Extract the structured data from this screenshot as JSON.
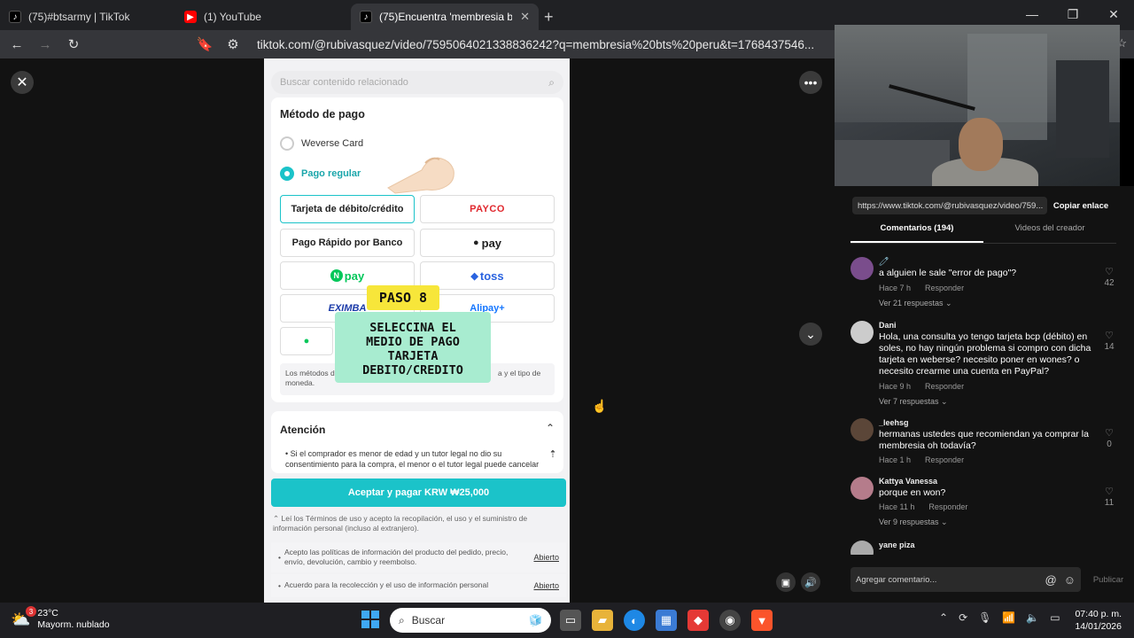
{
  "browser": {
    "tabs": [
      {
        "label": "(75)#btsarmy | TikTok",
        "icon": "tiktok-icon",
        "active": false
      },
      {
        "label": "(1) YouTube",
        "icon": "youtube-icon",
        "active": false
      },
      {
        "label": "(75)Encuentra 'membresia bts",
        "icon": "tiktok-icon",
        "active": true
      }
    ],
    "url": "tiktok.com/@rubivasquez/video/7595064021338836242?q=membresia%20bts%20peru&t=1768437546..."
  },
  "phone": {
    "search_placeholder": "Buscar contenido relacionado",
    "method_title": "Método de pago",
    "radio_weverse": "Weverse Card",
    "radio_regular": "Pago regular",
    "buttons": {
      "tarjeta": "Tarjeta de débito/crédito",
      "payco": "PAYCO",
      "banco": "Pago Rápido por Banco",
      "pay": "pay",
      "npay": "pay",
      "toss": "toss",
      "eximbay": "EXIMBA",
      "alipay": "Alipay+"
    },
    "note_start": "Los métodos d",
    "note_end": "a y el tipo de",
    "note_line2": "moneda.",
    "atencion_title": "Atención",
    "atencion_body": "Si el comprador es menor de edad y un tutor legal no dio su consentimiento para la compra, el menor o el tutor legal puede cancelar",
    "cta": "Aceptar y pagar KRW ₩25,000",
    "terms": "Leí los Términos de uso y acepto la recopilación, el uso y el suministro de información personal (incluso al extranjero).",
    "policy1": "Acepto las políticas de información del producto del pedido, precio, envío, devolución, cambio y reembolso.",
    "policy2": "Acuerdo para la recolección y el uso de información personal",
    "abierto": "Abierto"
  },
  "overlay": {
    "step": "PASO 8",
    "line1": "SELECCINA EL",
    "line2": "MEDIO DE PAGO",
    "line3": "TARJETA",
    "line4": "DEBITO/CREDITO"
  },
  "side": {
    "link": "https://www.tiktok.com/@rubivasquez/video/759...",
    "copy": "Copiar enlace",
    "tab_comments": "Comentarios (194)",
    "tab_videos": "Videos del creador",
    "comments": [
      {
        "name": "🧷",
        "text": "a alguien le sale \"error de pago\"?",
        "time": "Hace 7 h",
        "reply": "Responder",
        "likes": "42",
        "replies": "Ver 21 respuestas ⌄"
      },
      {
        "name": "Dani",
        "text": "Hola, una consulta yo tengo tarjeta bcp (débito) en soles, no hay ningún problema si compro con dicha tarjeta en weberse? necesito poner en wones? o necesito crearme una cuenta en PayPal?",
        "time": "Hace 9 h",
        "reply": "Responder",
        "likes": "14",
        "replies": "Ver 7 respuestas ⌄"
      },
      {
        "name": "_leehsg",
        "text": "hermanas ustedes que recomiendan ya comprar la membresia oh todavía?",
        "time": "Hace 1 h",
        "reply": "Responder",
        "likes": "0",
        "replies": ""
      },
      {
        "name": "Kattya Vanessa",
        "text": "porque en won?",
        "time": "Hace 11 h",
        "reply": "Responder",
        "likes": "11",
        "replies": "Ver 9 respuestas ⌄"
      },
      {
        "name": "yane piza",
        "text": "",
        "time": "",
        "reply": "",
        "likes": "",
        "replies": ""
      }
    ],
    "composer": "Agregar comentario...",
    "publish": "Publicar"
  },
  "taskbar": {
    "temp": "23°C",
    "weather": "Mayorm. nublado",
    "badge": "3",
    "search": "Buscar",
    "time": "07:40 p. m.",
    "date": "14/01/2026"
  },
  "colors": {
    "accent": "#1bc3c9",
    "overlay_yellow": "#f7e63a",
    "overlay_green": "#a8ecd0"
  }
}
